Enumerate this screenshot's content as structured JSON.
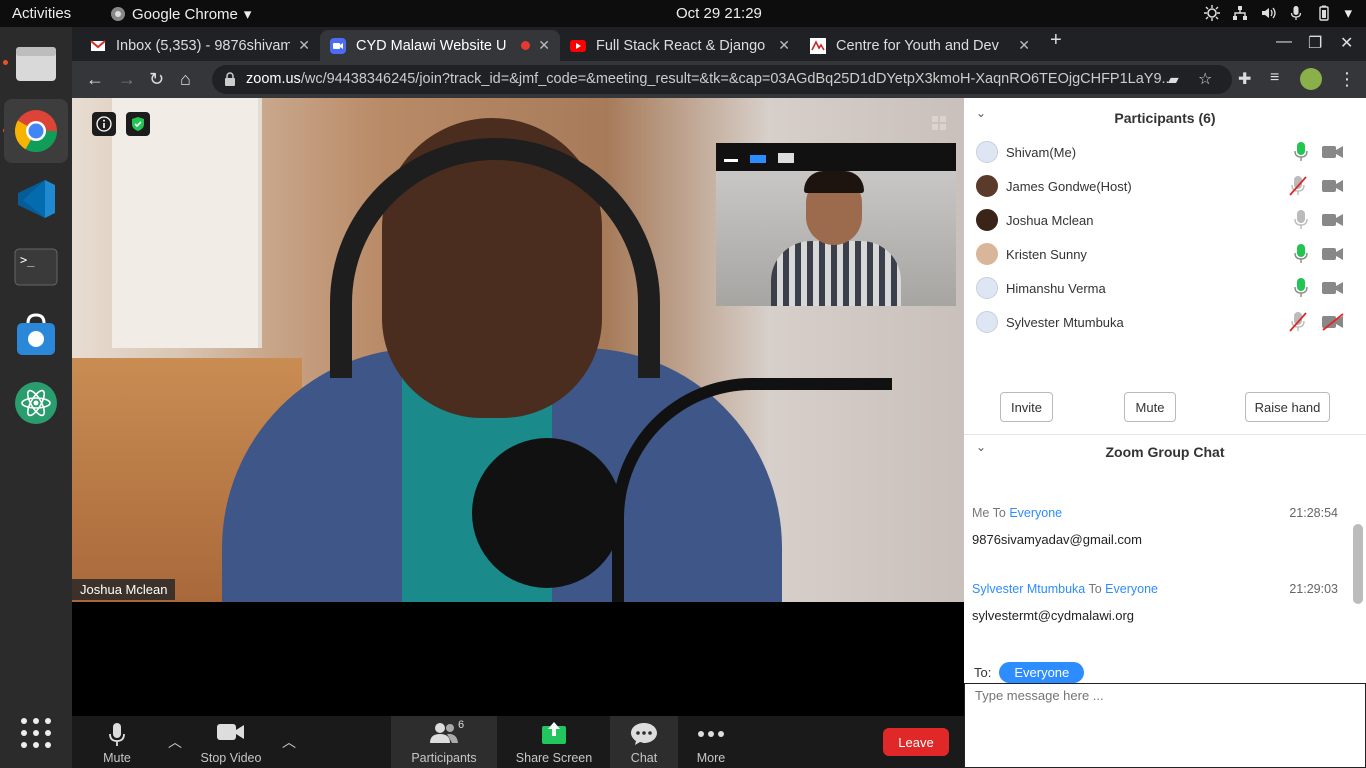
{
  "system": {
    "activities": "Activities",
    "app_menu": "Google Chrome",
    "clock": "Oct 29  21:29"
  },
  "tabs": [
    {
      "title": "Inbox (5,353) - 9876shivam",
      "icon": "gmail-icon"
    },
    {
      "title": "CYD Malawi Website U",
      "icon": "zoom-icon"
    },
    {
      "title": "Full Stack React & Django",
      "icon": "youtube-icon"
    },
    {
      "title": "Centre for Youth and Dev",
      "icon": "site-icon"
    }
  ],
  "address": {
    "host": "zoom.us",
    "path": "/wc/94438346245/join?track_id=&jmf_code=&meeting_result=&tk=&cap=03AGdBq25D1dDYetpX3kmoH-XaqnRO6TEOjgCHFP1LaY9..."
  },
  "meeting": {
    "speaker_name": "Joshua Mclean"
  },
  "controls": {
    "mute": "Mute",
    "stop_video": "Stop Video",
    "participants": "Participants",
    "participants_count": "6",
    "share_screen": "Share Screen",
    "chat": "Chat",
    "more": "More",
    "leave": "Leave"
  },
  "participants": {
    "title": "Participants (6)",
    "list": [
      {
        "name": "Shivam(Me)",
        "mic": "on"
      },
      {
        "name": "James Gondwe(Host)",
        "mic": "muted"
      },
      {
        "name": "Joshua Mclean",
        "mic": "off"
      },
      {
        "name": "Kristen Sunny",
        "mic": "on"
      },
      {
        "name": "Himanshu Verma",
        "mic": "on"
      },
      {
        "name": "Sylvester Mtumbuka",
        "mic": "muted"
      }
    ],
    "invite": "Invite",
    "mute": "Mute",
    "raise_hand": "Raise hand"
  },
  "chat": {
    "title": "Zoom Group Chat",
    "messages": [
      {
        "from": "Me",
        "to_word": "To",
        "to": "Everyone",
        "time": "21:28:54",
        "text": "9876sivamyadav@gmail.com"
      },
      {
        "from": "Sylvester Mtumbuka",
        "to_word": "To",
        "to": "Everyone",
        "time": "21:29:03",
        "text": "sylvestermt@cydmalawi.org"
      }
    ],
    "to_label": "To:",
    "to_value": "Everyone",
    "placeholder": "Type message here ..."
  },
  "colors": {
    "zoom_blue": "#2d8cff",
    "leave_red": "#e02828",
    "share_green": "#22c55e",
    "mic_green": "#23c552"
  }
}
